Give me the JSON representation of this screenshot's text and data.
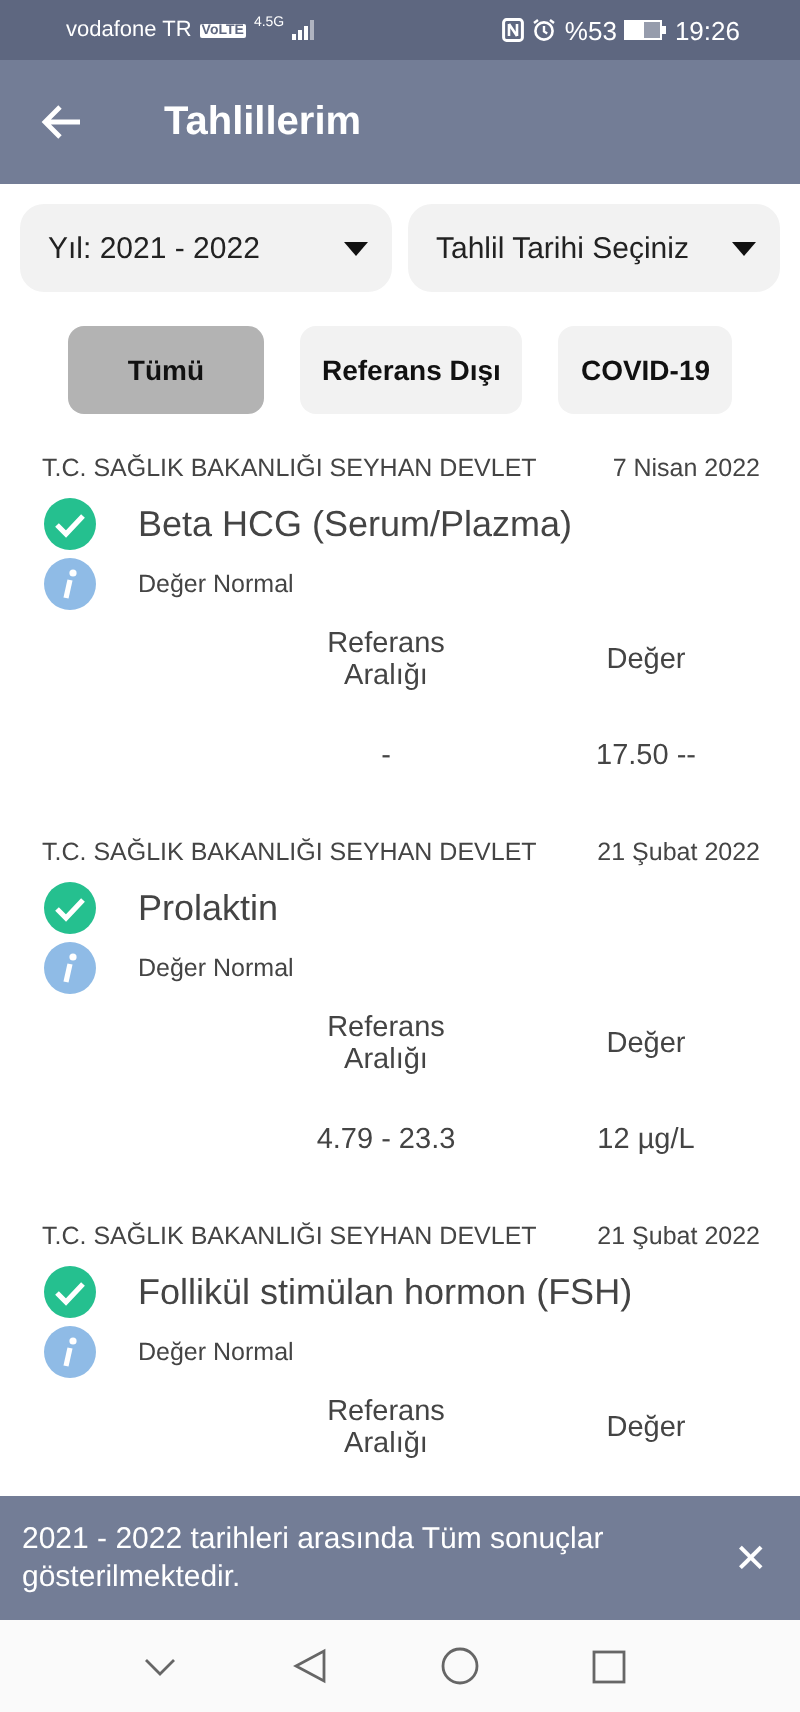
{
  "status_bar": {
    "carrier": "vodafone TR",
    "volte": "VoLTE",
    "network": "4.5G",
    "battery": "%53",
    "time": "19:26"
  },
  "app_bar": {
    "title": "Tahlillerim"
  },
  "dropdowns": [
    {
      "label": "Yıl: 2021 - 2022"
    },
    {
      "label": "Tahlil Tarihi Seçiniz"
    }
  ],
  "filters": [
    {
      "label": "Tümü",
      "selected": true
    },
    {
      "label": "Referans Dışı",
      "selected": false
    },
    {
      "label": "COVID-19",
      "selected": false
    }
  ],
  "results": [
    {
      "institution": "T.C. SAĞLIK BAKANLIĞI SEYHAN DEVLET",
      "date": "7 Nisan 2022",
      "test": "Beta HCG (Serum/Plazma)",
      "status": "Değer Normal",
      "range_header": "Referans Aralığı",
      "value_header": "Değer",
      "range": "-",
      "value": "17.50 --"
    },
    {
      "institution": "T.C. SAĞLIK BAKANLIĞI SEYHAN DEVLET",
      "date": "21 Şubat 2022",
      "test": "Prolaktin",
      "status": "Değer Normal",
      "range_header": "Referans Aralığı",
      "value_header": "Değer",
      "range": "4.79 - 23.3",
      "value": "12 µg/L"
    },
    {
      "institution": "T.C. SAĞLIK BAKANLIĞI SEYHAN DEVLET",
      "date": "21 Şubat 2022",
      "test": "Follikül stimülan hormon (FSH)",
      "status": "Değer Normal",
      "range_header": "Referans Aralığı",
      "value_header": "Değer"
    }
  ],
  "snackbar": {
    "message": "2021 - 2022 tarihleri arasında Tüm sonuçlar gösterilmektedir.",
    "close": "✕"
  }
}
